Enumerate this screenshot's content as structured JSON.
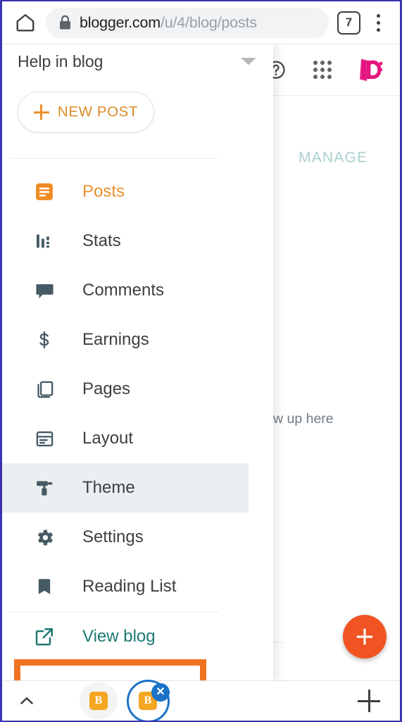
{
  "browser": {
    "home_icon": "home-icon",
    "lock_icon": "lock-icon",
    "url_host": "blogger.com",
    "url_path": "/u/4/blog/posts",
    "tab_count": "7",
    "overflow_icon": "three-dot-menu-icon",
    "bottom": {
      "expand_icon": "chevron-up-icon",
      "tabs": [
        {
          "label": "B",
          "state": "inactive",
          "icon": "blogger-tab-icon"
        },
        {
          "label": "B",
          "state": "active",
          "icon": "blogger-tab-icon"
        }
      ],
      "close_badge": "✕",
      "new_tab_icon": "plus-icon"
    }
  },
  "app": {
    "topbar": {
      "help_icon": "help-circle-icon",
      "apps_icon": "apps-grid-icon",
      "avatar_icon": "user-avatar"
    },
    "manage_label": "MANAGE",
    "empty_hint": "w up here",
    "fab": {
      "icon": "plus-icon",
      "color": "#f05423"
    }
  },
  "drawer": {
    "blog_title": "Help in blog",
    "caret_icon": "chevron-down-icon",
    "new_post": {
      "label": "NEW POST",
      "icon": "plus-icon",
      "color": "#dd8a26"
    },
    "items": [
      {
        "label": "Posts",
        "icon": "posts-icon",
        "state": "active"
      },
      {
        "label": "Stats",
        "icon": "stats-icon",
        "state": "normal"
      },
      {
        "label": "Comments",
        "icon": "comments-icon",
        "state": "normal"
      },
      {
        "label": "Earnings",
        "icon": "earnings-icon",
        "state": "normal"
      },
      {
        "label": "Pages",
        "icon": "pages-icon",
        "state": "normal"
      },
      {
        "label": "Layout",
        "icon": "layout-icon",
        "state": "normal"
      },
      {
        "label": "Theme",
        "icon": "theme-icon",
        "state": "highlighted"
      },
      {
        "label": "Settings",
        "icon": "settings-gear-icon",
        "state": "normal"
      },
      {
        "label": "Reading List",
        "icon": "bookmark-icon",
        "state": "normal"
      },
      {
        "label": "View blog",
        "icon": "external-link-icon",
        "state": "external"
      }
    ],
    "annotation": {
      "target": "View blog",
      "color": "#f07322"
    }
  },
  "colors": {
    "accent_orange": "#e8912c",
    "teal": "#1c7a72",
    "annotation_orange": "#f07322",
    "fab_orange": "#f05423",
    "highlight_gray": "#eceff1",
    "blue": "#1a73c8",
    "avatar_pink": "#e5167f"
  }
}
